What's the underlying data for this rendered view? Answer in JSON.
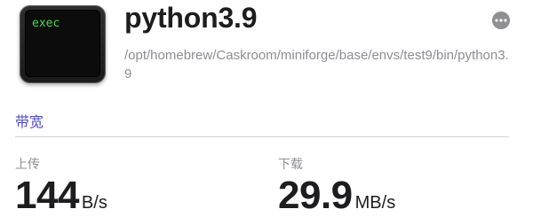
{
  "app": {
    "icon_name": "terminal-exec-icon",
    "icon_label": "exec",
    "title": "python3.9",
    "path": "/opt/homebrew/Caskroom/miniforge/base/envs/test9/bin/python3.9"
  },
  "actions": {
    "more_icon": "ellipsis-circle-icon"
  },
  "bandwidth": {
    "section_title": "带宽",
    "upload": {
      "label": "上传",
      "value": "144",
      "unit": "B/s"
    },
    "download": {
      "label": "下载",
      "value": "29.9",
      "unit": "MB/s"
    }
  },
  "colors": {
    "accent": "#4e48c9",
    "secondary_text": "#8e8e93",
    "terminal_green": "#3ee04a"
  }
}
